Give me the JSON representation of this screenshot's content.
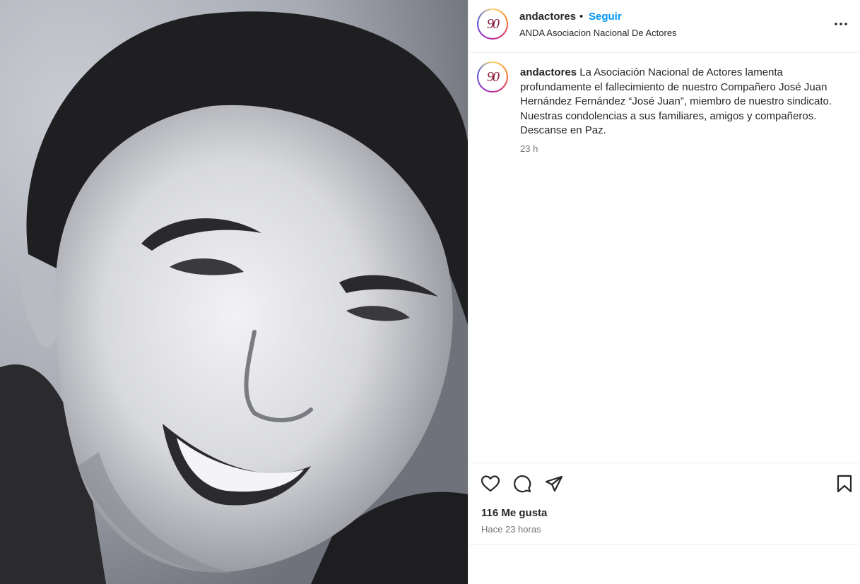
{
  "post": {
    "username": "andactores",
    "separator": "•",
    "follow_label": "Seguir",
    "profile_name": "ANDA Asociacion Nacional De Actores",
    "avatar_text": "90",
    "caption_username": "andactores",
    "caption_text": "La Asociación Nacional de Actores lamenta profundamente el fallecimiento de nuestro Compañero José Juan Hernández Fernández “José Juan”, miembro de nuestro sindicato. Nuestras condolencias a sus familiares, amigos y compañeros. Descanse en Paz.",
    "caption_time": "23 h",
    "likes": "116 Me gusta",
    "posted_ago": "Hace 23 horas"
  },
  "icons": {
    "more": "more-options-icon",
    "like": "heart-icon",
    "comment": "comment-icon",
    "share": "share-icon",
    "save": "bookmark-icon"
  },
  "colors": {
    "follow": "#0095f6",
    "text": "#262626",
    "muted": "#737373",
    "border": "#efefef"
  }
}
